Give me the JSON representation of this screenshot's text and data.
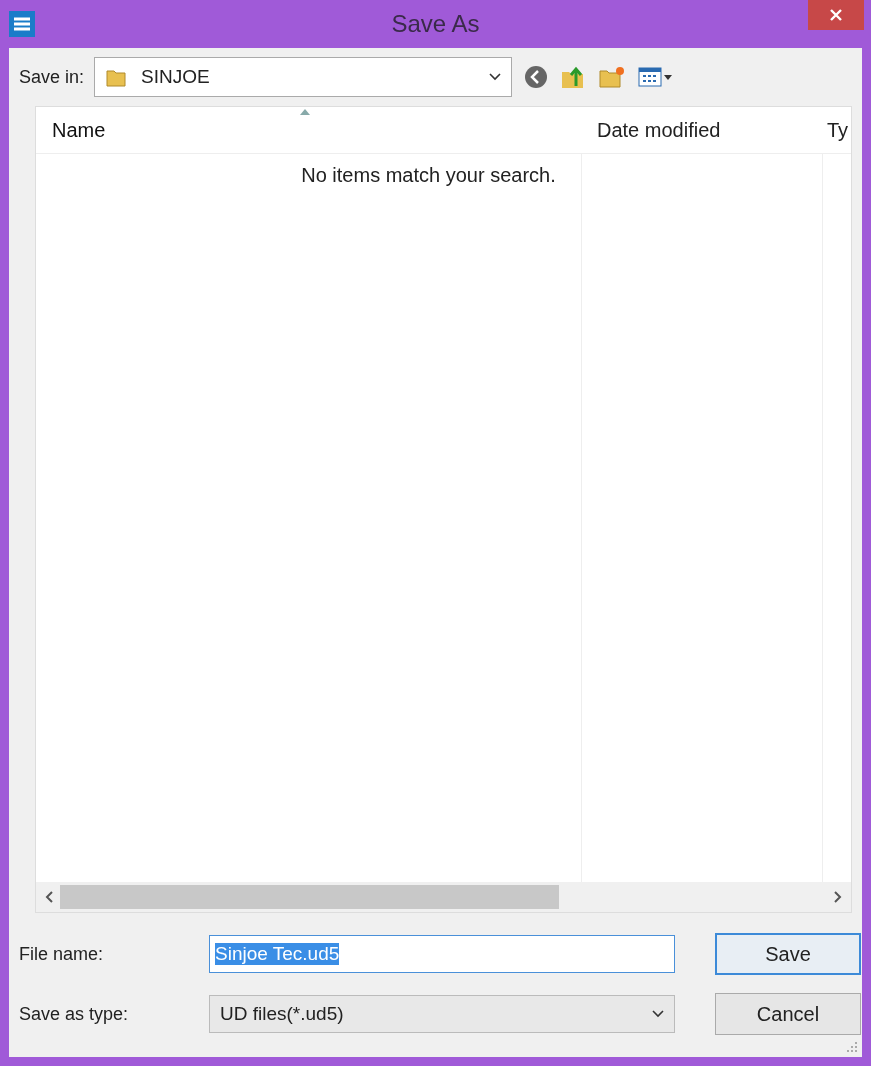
{
  "window": {
    "title": "Save As"
  },
  "save_in": {
    "label": "Save in:",
    "value": "SINJOE"
  },
  "file_list": {
    "columns": [
      {
        "label": "Name",
        "sorted": true
      },
      {
        "label": "Date modified",
        "sorted": false
      },
      {
        "label": "Ty",
        "sorted": false
      }
    ],
    "empty_message": "No items match your search."
  },
  "file_name": {
    "label": "File name:",
    "value": "Sinjoe Tec.ud5"
  },
  "save_as_type": {
    "label": "Save as type:",
    "value": "UD files(*.ud5)"
  },
  "buttons": [
    {
      "label": "Save",
      "default": true
    },
    {
      "label": "Cancel",
      "default": false
    }
  ]
}
